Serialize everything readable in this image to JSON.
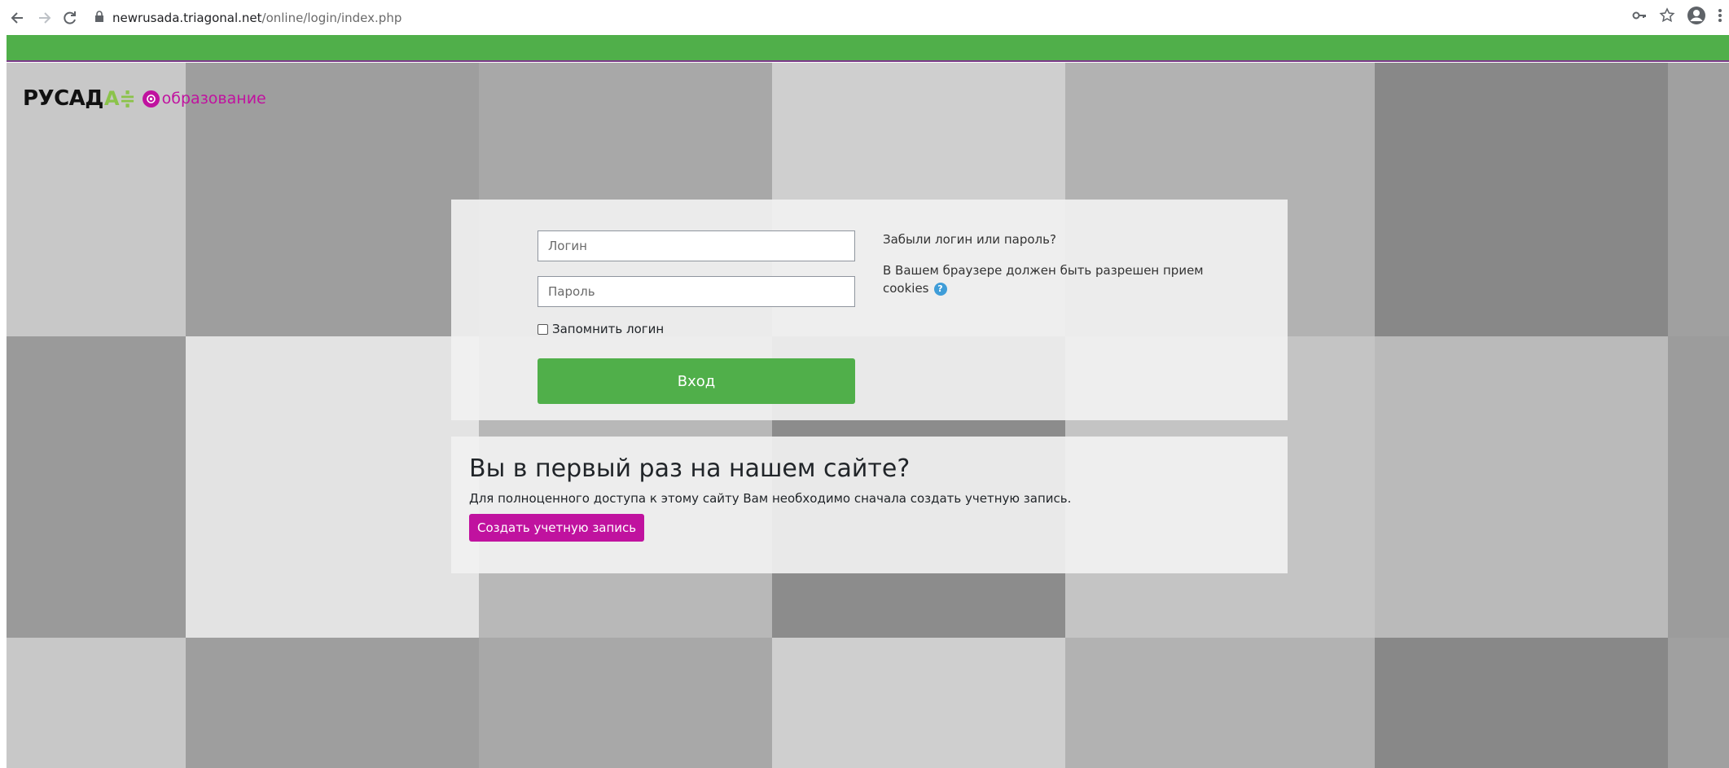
{
  "browser": {
    "url_host": "newrusada.triagonal.net",
    "url_path": "/online/login/index.php"
  },
  "logo": {
    "main": "РУСАД",
    "accent": "А≑",
    "sub": "образование"
  },
  "login": {
    "username_placeholder": "Логин",
    "password_placeholder": "Пароль",
    "remember_label": "Запомнить логин",
    "login_button": "Вход",
    "forgot_link": "Забыли логин или пароль?",
    "cookies_notice": "В Вашем браузере должен быть разрешен прием cookies"
  },
  "signup": {
    "title": "Вы в первый раз на нашем сайте?",
    "text": "Для полноценного доступа к этому сайту Вам необходимо сначала создать учетную запись.",
    "button": "Создать учетную запись"
  },
  "colors": {
    "brand_green": "#50af4a",
    "brand_magenta": "#c0129f"
  }
}
